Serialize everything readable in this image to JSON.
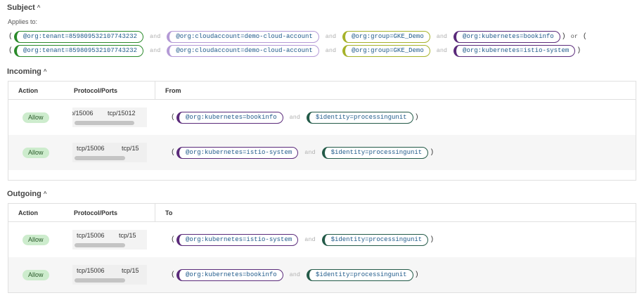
{
  "subject": {
    "title": "Subject",
    "applies_label": "Applies to:",
    "groups": [
      {
        "tags": [
          "@org:tenant=859809532107743232",
          "@org:cloudaccount=demo-cloud-account",
          "@org:group=GKE_Demo",
          "@org:kubernetes=bookinfo"
        ],
        "joiner": "or"
      },
      {
        "tags": [
          "@org:tenant=859809532107743232",
          "@org:cloudaccount=demo-cloud-account",
          "@org:group=GKE_Demo",
          "@org:kubernetes=istio-system"
        ]
      }
    ],
    "and": "and"
  },
  "colors": {
    "tenant": "#2a8a2a",
    "cloudaccount": "#b49ad6",
    "group": "#a6b22a",
    "kubernetes": "#5a2a7a",
    "identity": "#235a48",
    "allow_bg": "#cdeccd"
  },
  "incoming": {
    "title": "Incoming",
    "headers": {
      "action": "Action",
      "ports": "Protocol/Ports",
      "peer": "From"
    },
    "rows": [
      {
        "action": "Allow",
        "port1": "p/15006",
        "port2": "tcp/15012",
        "tags": [
          "@org:kubernetes=bookinfo",
          "$identity=processingunit"
        ]
      },
      {
        "action": "Allow",
        "port1": "tcp/15006",
        "port2": "tcp/15",
        "tags": [
          "@org:kubernetes=istio-system",
          "$identity=processingunit"
        ]
      }
    ]
  },
  "outgoing": {
    "title": "Outgoing",
    "headers": {
      "action": "Action",
      "ports": "Protocol/Ports",
      "peer": "To"
    },
    "rows": [
      {
        "action": "Allow",
        "port1": "tcp/15006",
        "port2": "tcp/15",
        "tags": [
          "@org:kubernetes=istio-system",
          "$identity=processingunit"
        ]
      },
      {
        "action": "Allow",
        "port1": "tcp/15006",
        "port2": "tcp/15",
        "tags": [
          "@org:kubernetes=bookinfo",
          "$identity=processingunit"
        ]
      }
    ]
  },
  "icons": {
    "collapse": "chevron-up-icon"
  }
}
